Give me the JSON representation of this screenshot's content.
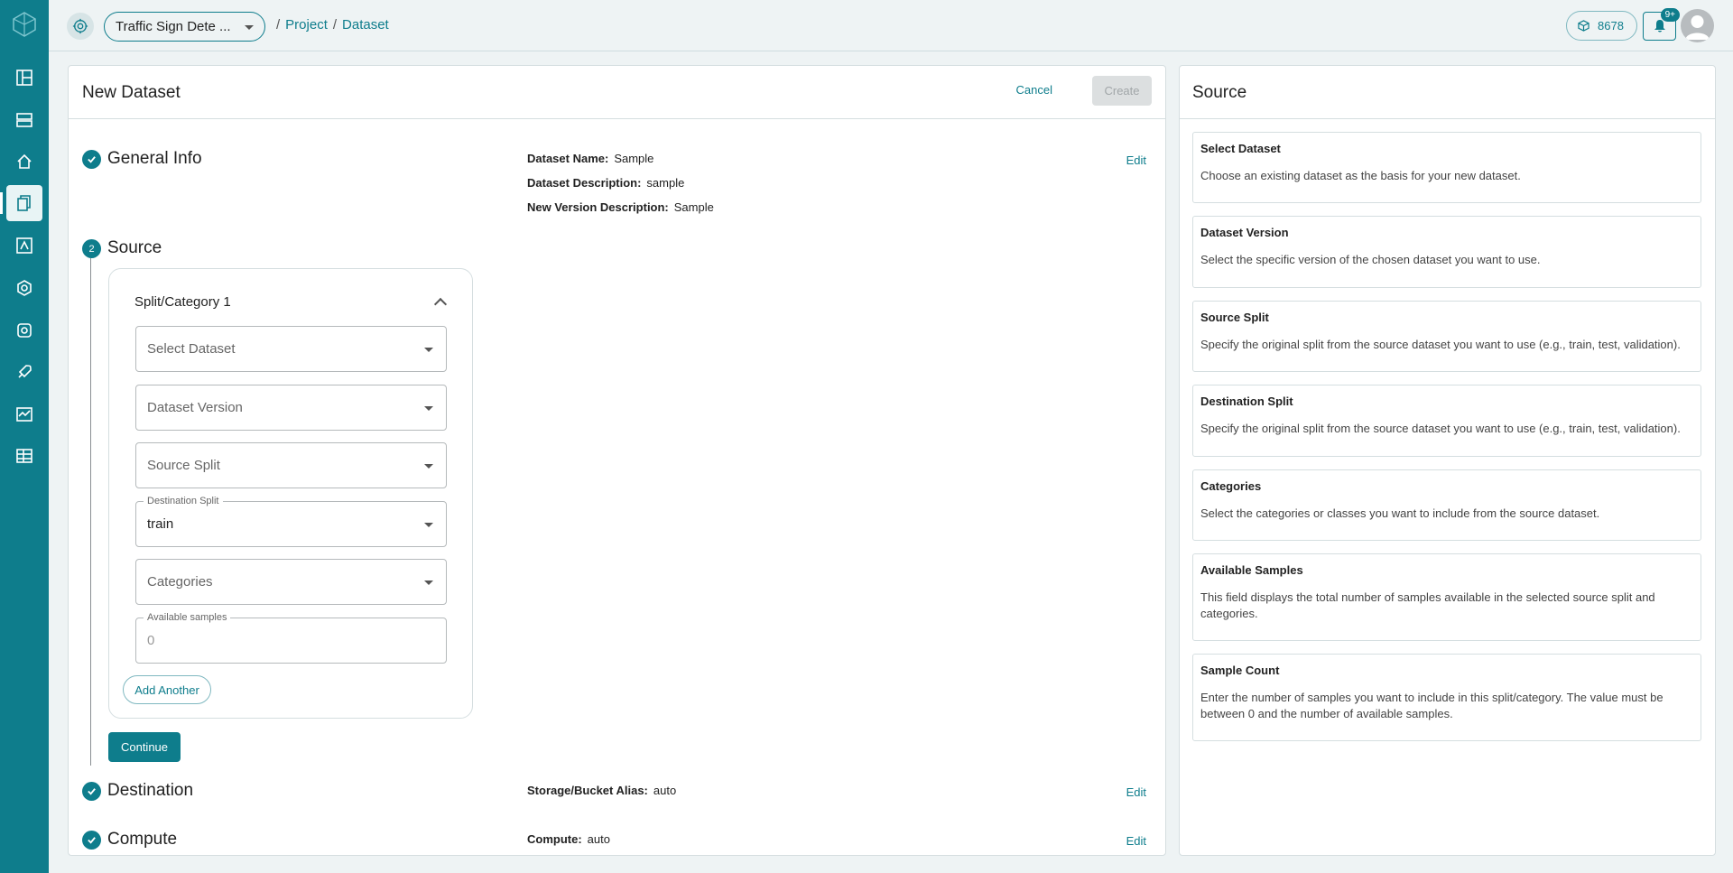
{
  "topbar": {
    "project_name": "Traffic Sign Dete ...",
    "breadcrumbs": [
      "Project",
      "Dataset"
    ],
    "breadcrumb_sep": "/",
    "credits": "8678",
    "notifications_badge": "9+"
  },
  "form": {
    "title": "New Dataset",
    "cancel_label": "Cancel",
    "create_label": "Create",
    "general_info": {
      "title": "General Info",
      "edit_label": "Edit",
      "name_label": "Dataset Name:",
      "name_value": "Sample",
      "description_label": "Dataset Description:",
      "description_value": "sample",
      "version_desc_label": "New Version Description:",
      "version_desc_value": "Sample"
    },
    "source": {
      "step_number": "2",
      "title": "Source",
      "split_title": "Split/Category 1",
      "select_dataset_placeholder": "Select Dataset",
      "dataset_version_placeholder": "Dataset Version",
      "source_split_placeholder": "Source Split",
      "destination_split_label": "Destination Split",
      "destination_split_value": "train",
      "categories_placeholder": "Categories",
      "available_samples_label": "Available samples",
      "available_samples_value": "0",
      "add_another_label": "Add Another",
      "continue_label": "Continue"
    },
    "destination": {
      "title": "Destination",
      "edit_label": "Edit",
      "storage_label": "Storage/Bucket Alias:",
      "storage_value": "auto"
    },
    "compute": {
      "title": "Compute",
      "edit_label": "Edit",
      "compute_label": "Compute:",
      "compute_value": "auto"
    }
  },
  "side": {
    "title": "Source",
    "items": [
      {
        "title": "Select Dataset",
        "desc": "Choose an existing dataset as the basis for your new dataset."
      },
      {
        "title": "Dataset Version",
        "desc": "Select the specific version of the chosen dataset you want to use."
      },
      {
        "title": "Source Split",
        "desc": "Specify the original split from the source dataset you want to use (e.g., train, test, validation)."
      },
      {
        "title": "Destination Split",
        "desc": "Specify the original split from the source dataset you want to use (e.g., train, test, validation)."
      },
      {
        "title": "Categories",
        "desc": "Select the categories or classes you want to include from the source dataset."
      },
      {
        "title": "Available Samples",
        "desc": "This field displays the total number of samples available in the selected source split and categories."
      },
      {
        "title": "Sample Count",
        "desc": "Enter the number of samples you want to include in this split/category. The value must be between 0 and the number of available samples."
      }
    ]
  },
  "colors": {
    "accent": "#0e7d8c",
    "sidebar_bg": "#0e7d8c",
    "page_bg": "#eef3f4"
  },
  "sidebar_icons": [
    "logo-icon",
    "dashboard-icon",
    "storage-icon",
    "home-icon",
    "datasets-icon",
    "annotation-icon",
    "models-icon",
    "settings-icon",
    "deploy-icon",
    "monitoring-icon",
    "table-icon"
  ]
}
